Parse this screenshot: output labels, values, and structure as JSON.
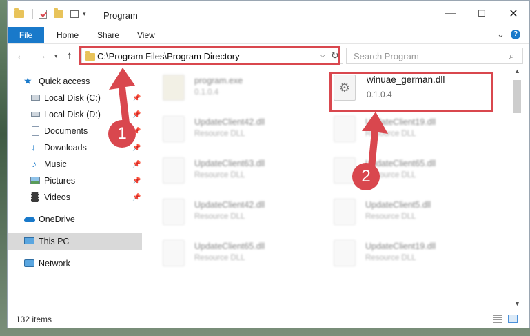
{
  "window": {
    "title": "Program",
    "controls": {
      "minimize": "—",
      "maximize": "☐",
      "close": "✕"
    }
  },
  "ribbon": {
    "tabs": [
      "File",
      "Home",
      "Share",
      "View"
    ],
    "expand_glyph": "⌄",
    "help_glyph": "?"
  },
  "address": {
    "path": "C:\\Program Files\\Program Directory",
    "search_placeholder": "Search Program"
  },
  "nav": {
    "quick_access": "Quick access",
    "items": [
      {
        "label": "Local Disk (C:)",
        "icon": "drive-icon"
      },
      {
        "label": "Local Disk (D:)",
        "icon": "drive-icon"
      },
      {
        "label": "Documents",
        "icon": "documents-icon"
      },
      {
        "label": "Downloads",
        "icon": "downloads-icon"
      },
      {
        "label": "Music",
        "icon": "music-icon"
      },
      {
        "label": "Pictures",
        "icon": "pictures-icon"
      },
      {
        "label": "Videos",
        "icon": "videos-icon"
      }
    ],
    "onedrive": "OneDrive",
    "this_pc": "This PC",
    "network": "Network"
  },
  "files": [
    {
      "name": "program.exe",
      "sub": "0.1.0.4"
    },
    {
      "name": "winuae_german.dll",
      "sub": "0.1.0.4"
    },
    {
      "name": "UpdateClient42.dll",
      "sub": "Resource DLL"
    },
    {
      "name": "UpdateClient19.dll",
      "sub": "Resource DLL"
    },
    {
      "name": "UpdateClient63.dll",
      "sub": "Resource DLL"
    },
    {
      "name": "UpdateClient65.dll",
      "sub": "Resource DLL"
    },
    {
      "name": "UpdateClient42.dll",
      "sub": "Resource DLL"
    },
    {
      "name": "UpdateClient5.dll",
      "sub": "Resource DLL"
    },
    {
      "name": "UpdateClient65.dll",
      "sub": "Resource DLL"
    },
    {
      "name": "UpdateClient19.dll",
      "sub": "Resource DLL"
    }
  ],
  "status": {
    "items": "132 items"
  },
  "annotations": {
    "step1": "1",
    "step2": "2",
    "color": "#d9474e"
  }
}
